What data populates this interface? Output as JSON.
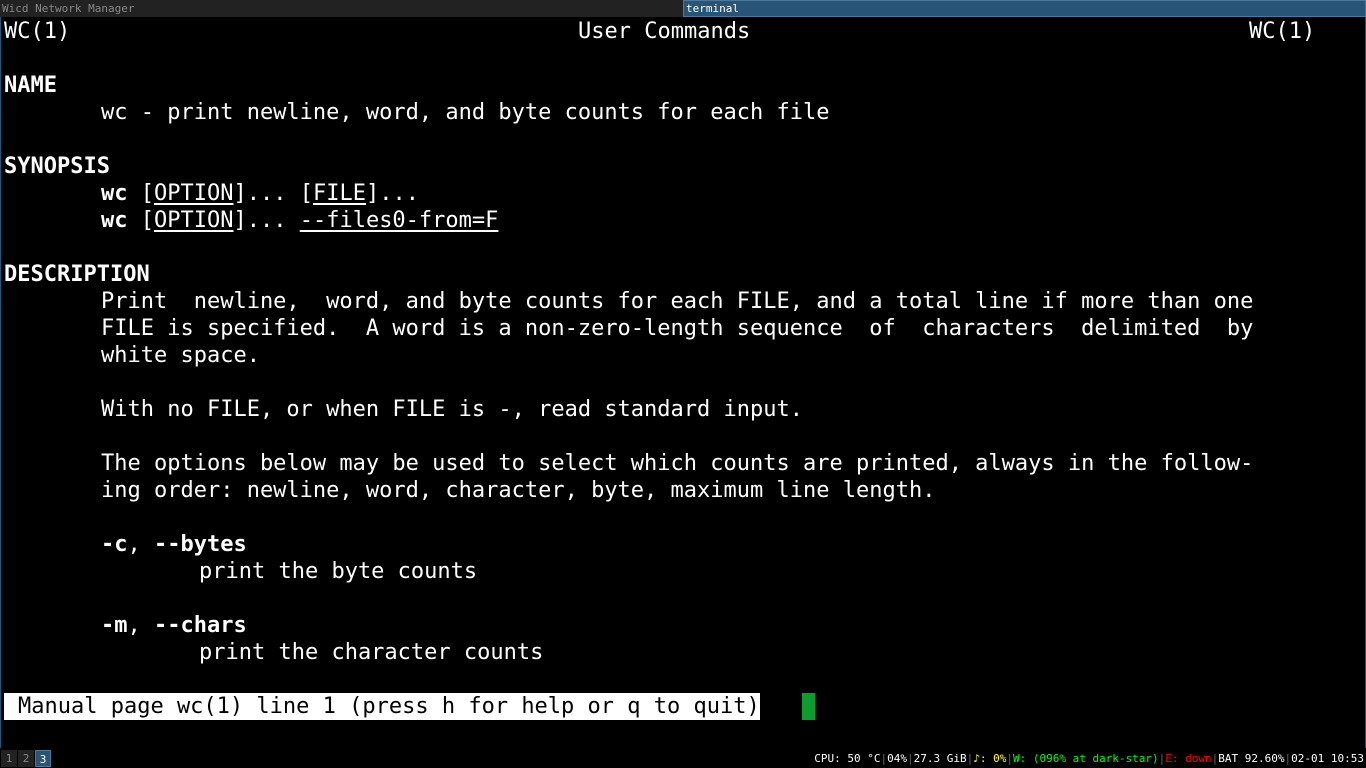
{
  "titlebar": {
    "tab_wicd": "Wicd Network Manager",
    "tab_terminal": "terminal"
  },
  "man": {
    "header_left": "WC(1)",
    "header_center": "User Commands",
    "header_right": "WC(1)",
    "name_heading": "NAME",
    "name_line": "wc - print newline, word, and byte counts for each file",
    "synopsis_heading": "SYNOPSIS",
    "syn1_cmd": "wc",
    "syn1_opt_open": " [",
    "syn1_opt": "OPTION",
    "syn1_opt_close": "]... ",
    "syn1_file_open": "[",
    "syn1_file": "FILE",
    "syn1_file_close": "]...",
    "syn2_cmd": "wc",
    "syn2_opt_open": " [",
    "syn2_opt": "OPTION",
    "syn2_opt_close": "]... ",
    "syn2_files0": "--files0-from=F",
    "description_heading": "DESCRIPTION",
    "desc_p1_l1": "Print  newline,  word, and byte counts for each FILE, and a total line if more than one",
    "desc_p1_l2": "FILE is specified.  A word is a non-zero-length sequence  of  characters  delimited  by",
    "desc_p1_l3": "white space.",
    "desc_p2": "With no FILE, or when FILE is -, read standard input.",
    "desc_p3_l1": "The options below may be used to select which counts are printed, always in the follow-",
    "desc_p3_l2": "ing order: newline, word, character, byte, maximum line length.",
    "opt_c_short": "-c",
    "opt_c_sep": ", ",
    "opt_c_long": "--bytes",
    "opt_c_desc": "print the byte counts",
    "opt_m_short": "-m",
    "opt_m_sep": ", ",
    "opt_m_long": "--chars",
    "opt_m_desc": "print the character counts",
    "status_line": "Manual page wc(1) line 1 (press h for help or q to quit)"
  },
  "workspaces": [
    "1",
    "2",
    "3"
  ],
  "statusbar": {
    "cpu": "CPU: 50 °C",
    "cpu_load": "04%",
    "disk": "27.3 GiB",
    "volume": "♪: 0%",
    "wifi": "W: (096% at dark-star)",
    "ethernet": "E: down",
    "battery": "BAT 92.60%",
    "datetime": "02-01 10:53"
  },
  "colors": {
    "accent": "#285577",
    "cursor": "#0d9c2d",
    "wifi": "#00ff00",
    "eth_down": "#ff0000"
  }
}
